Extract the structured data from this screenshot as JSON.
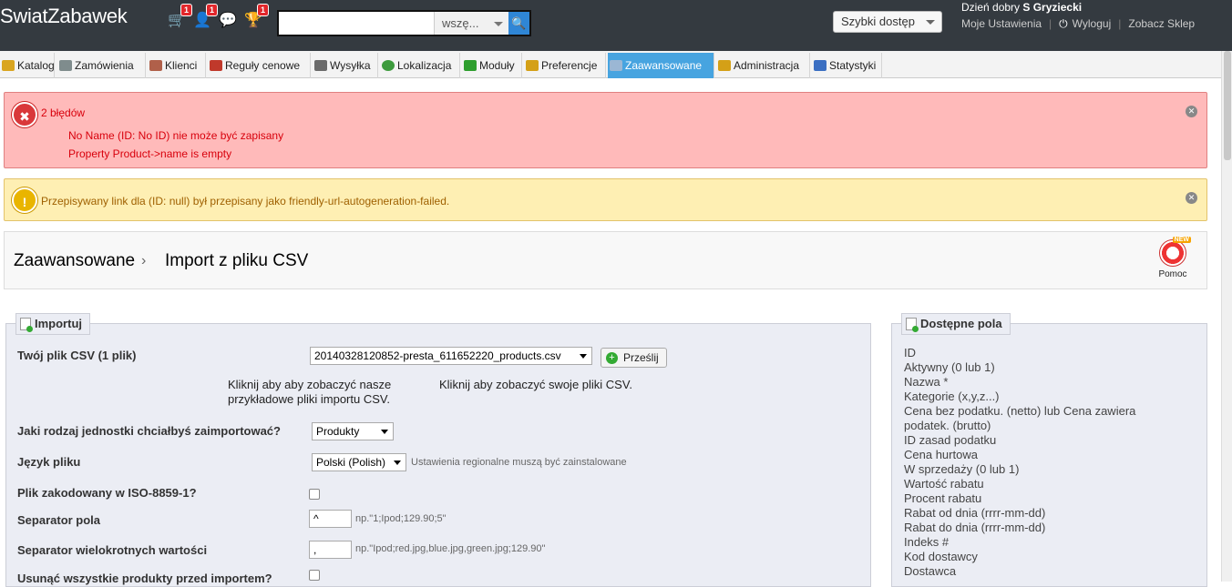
{
  "topbar": {
    "logo": "SwiatZabawek",
    "icons": [
      {
        "name": "cart-icon",
        "glyph": "🛒",
        "badge": "1"
      },
      {
        "name": "customers-icon",
        "glyph": "👤",
        "badge": "1"
      },
      {
        "name": "messages-icon",
        "glyph": "💬",
        "badge": ""
      },
      {
        "name": "trophy-icon",
        "glyph": "🏆",
        "badge": "1"
      }
    ],
    "search": {
      "value": "",
      "scope": "wszę...",
      "button_glyph": "🔍"
    },
    "quick_access": "Szybki dostęp",
    "greeting_prefix": "Dzień dobry",
    "user_name": "S Gryziecki",
    "links": {
      "settings": "Moje Ustawienia",
      "logout": "Wyloguj",
      "shop": "Zobacz Sklep"
    }
  },
  "nav": {
    "tabs": [
      {
        "label": "Katalog",
        "color": "#d9a520"
      },
      {
        "label": "Zamówienia",
        "color": "#7f8c8d"
      },
      {
        "label": "Klienci",
        "color": "#b0604a"
      },
      {
        "label": "Reguły cenowe",
        "color": "#c0392b"
      },
      {
        "label": "Wysyłka",
        "color": "#6b6b6b"
      },
      {
        "label": "Lokalizacja",
        "color": "#3d9b3d"
      },
      {
        "label": "Moduły",
        "color": "#2e9e2e"
      },
      {
        "label": "Preferencje",
        "color": "#d4a017"
      },
      {
        "label": "Zaawansowane",
        "color": "#9bb7d4"
      },
      {
        "label": "Administracja",
        "color": "#d4a017"
      },
      {
        "label": "Statystyki",
        "color": "#3b6fc2"
      }
    ],
    "active": "Zaawansowane"
  },
  "alerts": {
    "error": {
      "title": "2 błędów",
      "lines": [
        "No Name (ID: No ID) nie może być zapisany",
        "Property Product->name is empty"
      ]
    },
    "warning": {
      "text": "Przepisywany link dla (ID: null) był przepisany jako friendly-url-autogeneration-failed."
    }
  },
  "header": {
    "breadcrumb_parent": "Zaawansowane",
    "breadcrumb_sep": "›",
    "breadcrumb_current": "Import z pliku CSV",
    "help_label": "Pomoc",
    "help_badge": "NEW"
  },
  "import_panel": {
    "legend": "Importuj",
    "csv_label": "Twój plik CSV (1 plik)",
    "csv_file": "20140328120852-presta_611652220_products.csv",
    "upload_button": "Prześlij",
    "sample_link": "Kliknij aby aby zobaczyć nasze przykładowe pliki importu CSV.",
    "own_files_link": "Kliknij aby zobaczyć swoje pliki CSV.",
    "entity_label": "Jaki rodzaj jednostki chciałbyś zaimportować?",
    "entity_value": "Produkty",
    "language_label": "Język pliku",
    "language_value": "Polski (Polish)",
    "language_hint": "Ustawienia regionalne muszą być zainstalowane",
    "iso_label": "Plik zakodowany w ISO-8859-1?",
    "field_sep_label": "Separator pola",
    "field_sep_value": "^",
    "field_sep_hint": "np.\"1;Ipod;129.90;5\"",
    "multi_sep_label": "Separator wielokrotnych wartości",
    "multi_sep_value": ",",
    "multi_sep_hint": "np.\"Ipod;red.jpg,blue.jpg,green.jpg;129.90\"",
    "delete_label": "Usunąć wszystkie produkty przed importem?"
  },
  "fields_panel": {
    "legend": "Dostępne pola",
    "fields": [
      "ID",
      "Aktywny (0 lub 1)",
      "Nazwa *",
      "Kategorie (x,y,z...)",
      "Cena bez podatku. (netto) lub Cena zawiera podatek. (brutto)",
      "ID zasad podatku",
      "Cena hurtowa",
      "W sprzedaży (0 lub 1)",
      "Wartość rabatu",
      "Procent rabatu",
      "Rabat od dnia (rrrr-mm-dd)",
      "Rabat do dnia (rrrr-mm-dd)",
      "Indeks #",
      "Kod dostawcy",
      "Dostawca"
    ]
  }
}
